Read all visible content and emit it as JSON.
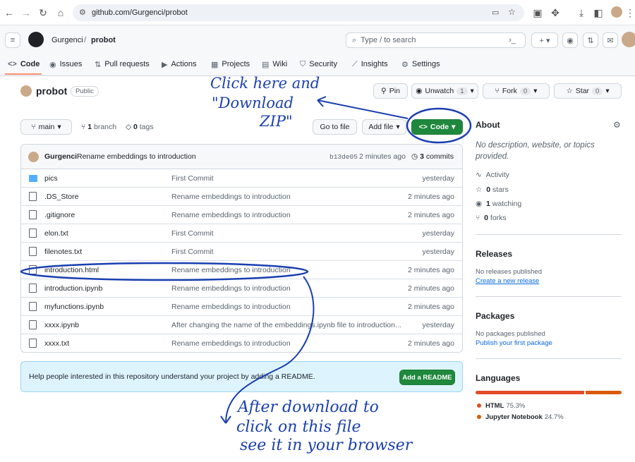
{
  "browser": {
    "url": "github.com/Gurgenci/probot"
  },
  "header": {
    "owner": "Gurgenci",
    "repo": "probot",
    "search_placeholder": "Type / to search"
  },
  "tabs": [
    {
      "label": "Code",
      "icon": "code-icon"
    },
    {
      "label": "Issues",
      "icon": "issue-icon"
    },
    {
      "label": "Pull requests",
      "icon": "pull-request-icon"
    },
    {
      "label": "Actions",
      "icon": "play-icon"
    },
    {
      "label": "Projects",
      "icon": "table-icon"
    },
    {
      "label": "Wiki",
      "icon": "book-icon"
    },
    {
      "label": "Security",
      "icon": "shield-icon"
    },
    {
      "label": "Insights",
      "icon": "graph-icon"
    },
    {
      "label": "Settings",
      "icon": "gear-icon"
    }
  ],
  "repo": {
    "name": "probot",
    "visibility": "Public",
    "pin": "Pin",
    "unwatch": "Unwatch",
    "watch_count": "1",
    "fork": "Fork",
    "fork_count": "0",
    "star": "Star",
    "star_count": "0"
  },
  "branchbar": {
    "branch": "main",
    "branch_count": "1",
    "branch_label": "branch",
    "tag_count": "0",
    "tag_label": "tags",
    "go_to_file": "Go to file",
    "add_file": "Add file",
    "code": "Code"
  },
  "commit": {
    "author": "Gurgenci",
    "message": "Rename embeddings to introduction",
    "hash": "b13de05",
    "time": "2 minutes ago",
    "count": "3",
    "count_label": "commits"
  },
  "files": [
    {
      "name": "pics",
      "type": "folder",
      "message": "First Commit",
      "time": "yesterday"
    },
    {
      "name": ".DS_Store",
      "type": "file",
      "message": "Rename embeddings to introduction",
      "time": "2 minutes ago"
    },
    {
      "name": ".gitignore",
      "type": "file",
      "message": "Rename embeddings to introduction",
      "time": "2 minutes ago"
    },
    {
      "name": "elon.txt",
      "type": "file",
      "message": "First Commit",
      "time": "yesterday"
    },
    {
      "name": "filenotes.txt",
      "type": "file",
      "message": "First Commit",
      "time": "yesterday"
    },
    {
      "name": "introduction.html",
      "type": "file",
      "message": "Rename embeddings to introduction",
      "time": "2 minutes ago"
    },
    {
      "name": "introduction.ipynb",
      "type": "file",
      "message": "Rename embeddings to introduction",
      "time": "2 minutes ago"
    },
    {
      "name": "myfunctions.ipynb",
      "type": "file",
      "message": "Rename embeddings to introduction",
      "time": "2 minutes ago"
    },
    {
      "name": "xxxx.ipynb",
      "type": "file",
      "message": "After changing the name of the embeddings.ipynb file to introduction...",
      "time": "yesterday"
    },
    {
      "name": "xxxx.txt",
      "type": "file",
      "message": "Rename embeddings to introduction",
      "time": "2 minutes ago"
    }
  ],
  "readme": {
    "text": "Help people interested in this repository understand your project by adding a README.",
    "button": "Add a README"
  },
  "about": {
    "title": "About",
    "description": "No description, website, or topics provided.",
    "activity": "Activity",
    "stars": "0",
    "stars_label": "stars",
    "watching": "1",
    "watching_label": "watching",
    "forks": "0",
    "forks_label": "forks"
  },
  "releases": {
    "title": "Releases",
    "empty": "No releases published",
    "link": "Create a new release"
  },
  "packages": {
    "title": "Packages",
    "empty": "No packages published",
    "link": "Publish your first package"
  },
  "languages": {
    "title": "Languages",
    "items": [
      {
        "name": "HTML",
        "percent": "75.3%",
        "value": 75.3,
        "color": "#e34c26"
      },
      {
        "name": "Jupyter Notebook",
        "percent": "24.7%",
        "value": 24.7,
        "color": "#DA5B0B"
      }
    ]
  },
  "annotations": {
    "top": [
      "Click here and",
      "\"Download",
      "ZIP\""
    ],
    "bottom": [
      "After download to",
      "click on this file",
      "see it in your browser"
    ]
  },
  "colors": {
    "accent": "#1f883d",
    "link": "#0969da",
    "ink": "#1a3fb0"
  }
}
